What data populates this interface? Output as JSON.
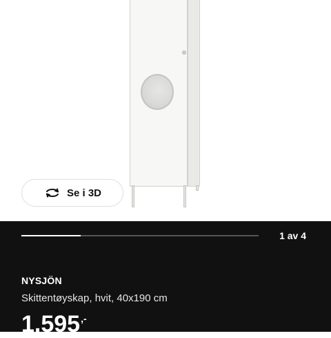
{
  "gallery": {
    "view3d_label": "Se i 3D",
    "view3d_icon": "rotate-3d-icon",
    "page_counter": "1 av 4",
    "progress_fraction": 0.25
  },
  "product": {
    "name": "NYSJÖN",
    "description": "Skittentøyskap, hvit, 40x190 cm",
    "price": "1.595",
    "price_suffix": ",-"
  },
  "colors": {
    "panel_background": "#111111",
    "text_light": "#ffffff",
    "button_border": "#dfdfdf"
  }
}
